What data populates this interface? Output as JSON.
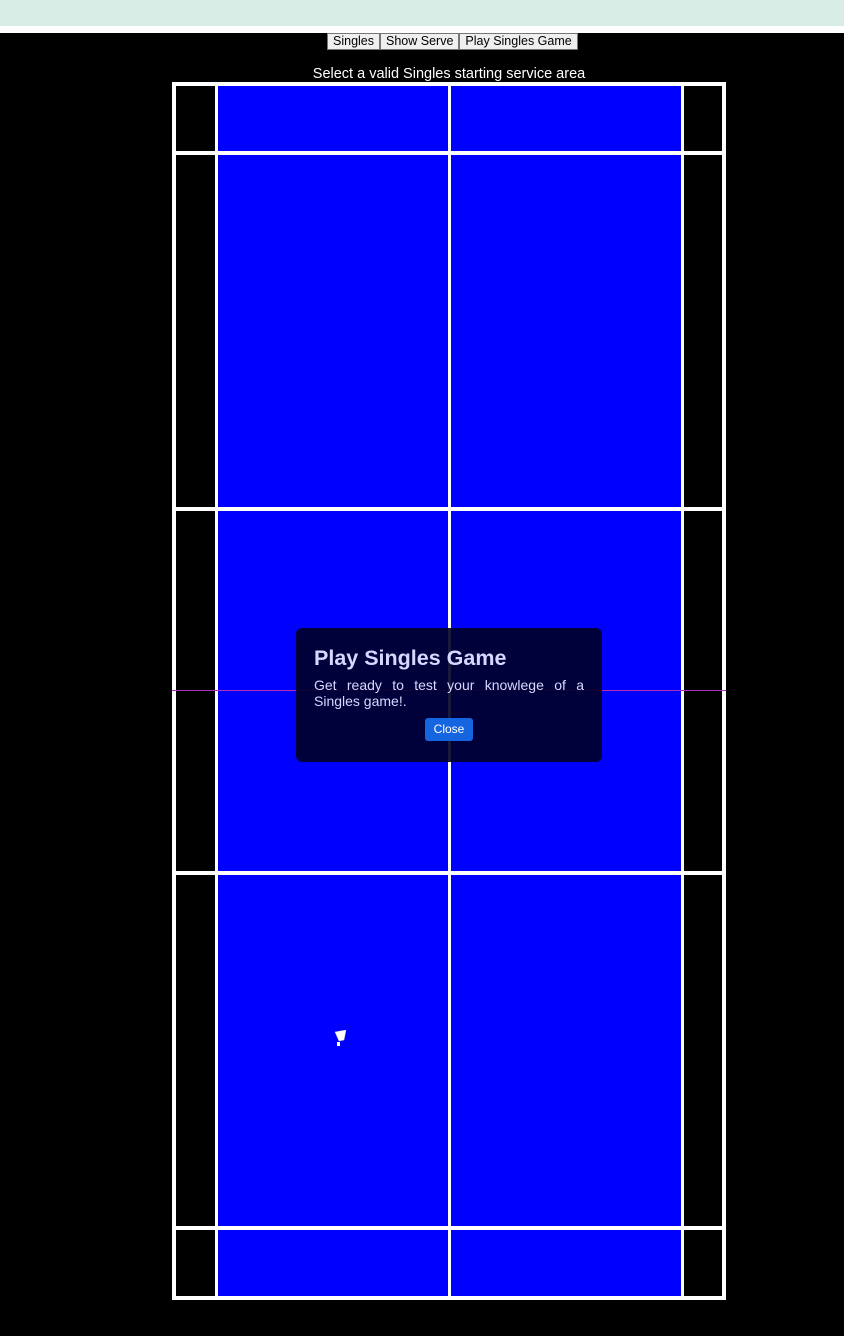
{
  "toolbar": {
    "buttons": [
      "Singles",
      "Show Serve",
      "Play Singles Game"
    ]
  },
  "instruction": "Select a valid Singles starting service area",
  "court": {
    "area_color": "#0000ff",
    "alley_color": "#000000",
    "line_color": "#ffffff",
    "net_line_color": "#b02cc0"
  },
  "modal": {
    "title": "Play Singles Game",
    "message": "Get ready to test your knowlege of a Singles game!.",
    "close_label": "Close",
    "button_color": "#1565e0"
  },
  "icons": {
    "shuttle": "shuttlecock-icon"
  }
}
